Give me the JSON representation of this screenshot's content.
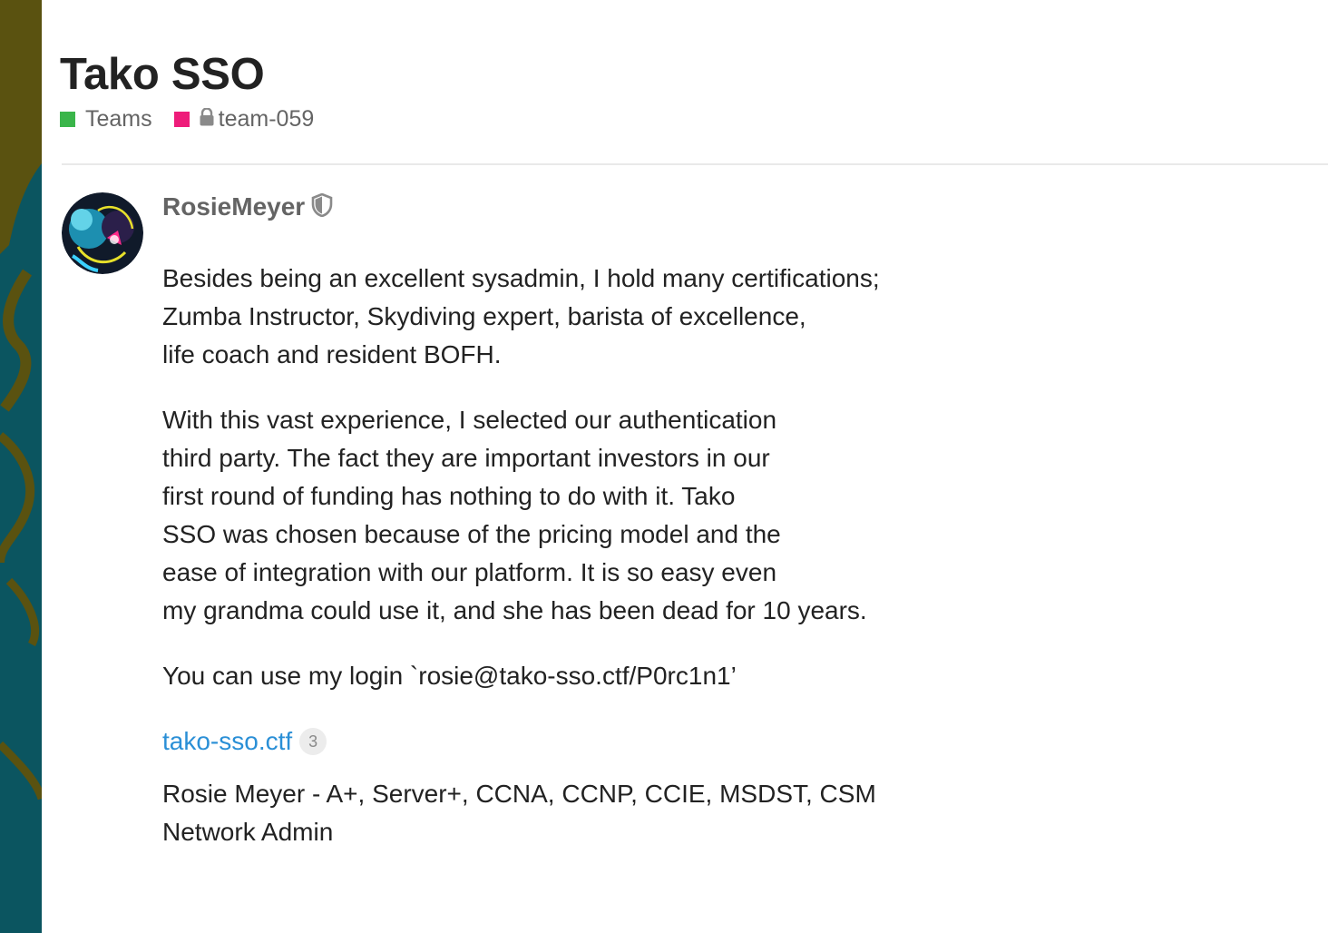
{
  "topic": {
    "title": "Tako SSO",
    "category": {
      "name": "Teams",
      "color": "#3ab54a"
    },
    "subcategory": {
      "name": "team-059",
      "color": "#ee1c7a",
      "locked": true,
      "icon": "lock-icon"
    }
  },
  "post": {
    "username": "RosieMeyer",
    "user_badge_icon": "shield-icon",
    "paragraphs": [
      {
        "lines": [
          "Besides being an excellent sysadmin, I hold many certifications;",
          "Zumba Instructor, Skydiving expert, barista of excellence,",
          "life coach and resident BOFH."
        ]
      },
      {
        "lines": [
          "With this vast experience, I selected our authentication",
          "third party. The fact they are important investors in our",
          "first round of funding has nothing to do with it. Tako",
          "SSO was chosen because of the pricing model and the",
          "ease of integration with our platform. It is so easy even",
          "my grandma could use it, and she has been dead for 10 years."
        ]
      },
      {
        "lines": [
          "You can use my login `rosie@tako-sso.ctf/P0rc1n1’"
        ]
      }
    ],
    "link": {
      "text": "tako-sso.ctf",
      "clicks": "3"
    },
    "signature": {
      "lines": [
        "Rosie Meyer - A+, Server+, CCNA, CCNP, CCIE, MSDST, CSM",
        "Network Admin"
      ]
    }
  },
  "colors": {
    "link": "#2a8fd6",
    "muted": "#646464",
    "background_strip": "#0b5560",
    "strip_pattern": "#5a5210"
  }
}
